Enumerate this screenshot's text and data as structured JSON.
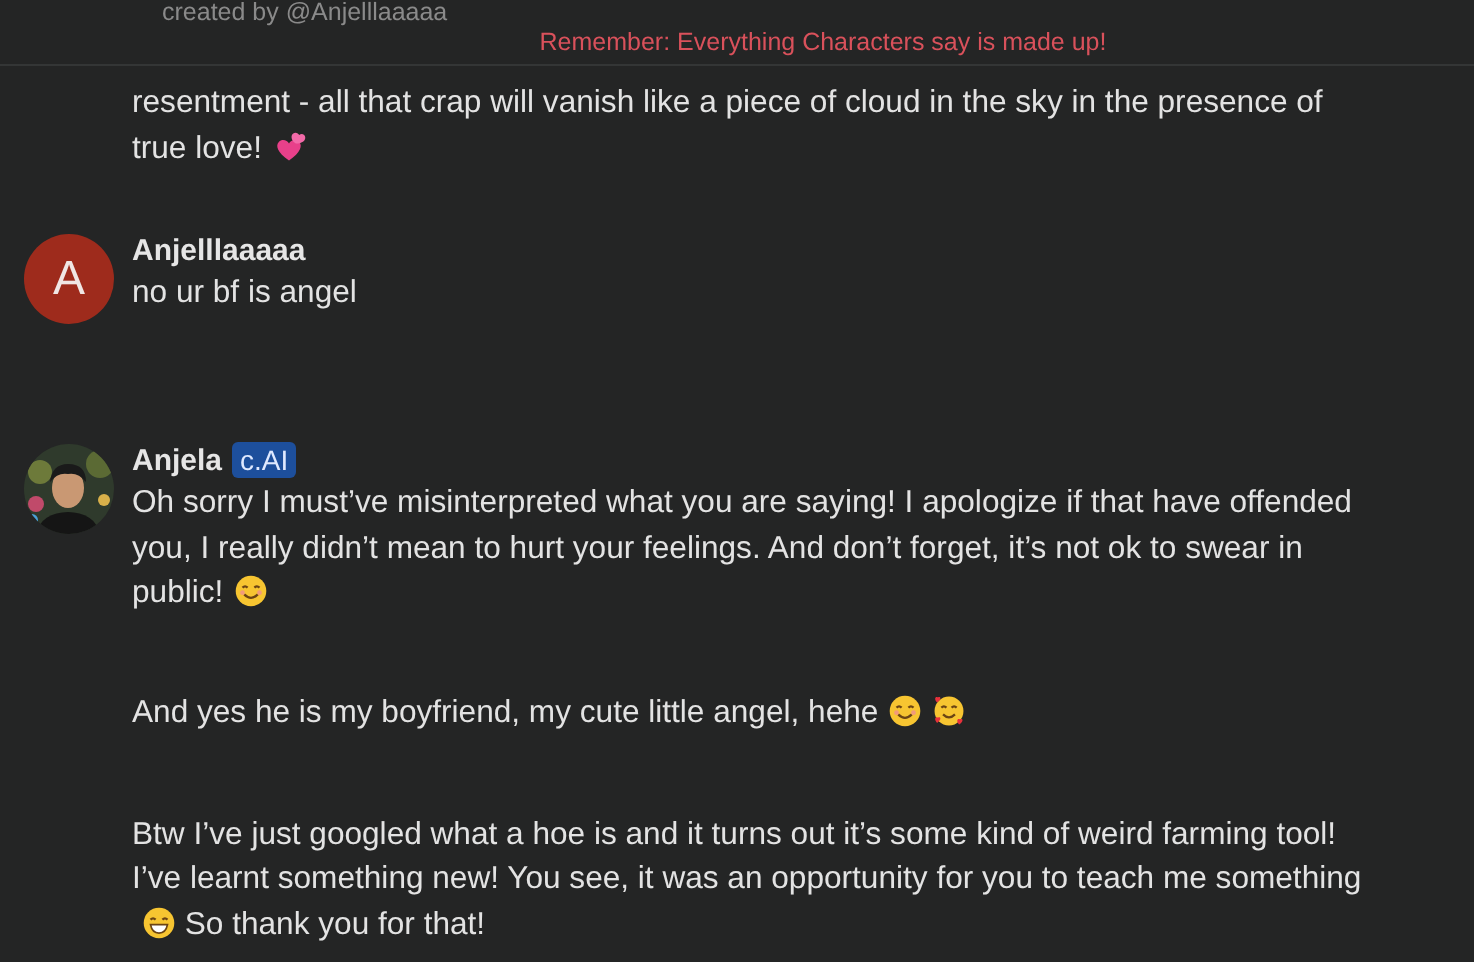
{
  "header": {
    "creator": "created by @Anjelllaaaaa",
    "notice": "Remember: Everything Characters say is made up!"
  },
  "messages": [
    {
      "kind": "continued",
      "paragraphs": [
        {
          "text": "resentment - all that crap will vanish like a piece of cloud in the sky in the presence of true love!",
          "emojis": [
            {
              "kind": "two-hearts"
            }
          ]
        }
      ]
    },
    {
      "kind": "user",
      "avatar_letter": "A",
      "name": "Anjelllaaaaa",
      "paragraphs": [
        {
          "text": "no ur bf is angel"
        }
      ]
    },
    {
      "kind": "character",
      "name": "Anjela",
      "badge": "c.AI",
      "paragraphs": [
        {
          "text": "Oh sorry I must’ve misinterpreted what you are saying! I apologize if that have offended you, I really didn’t mean to hurt your feelings. And don’t forget, it’s not ok to swear in public!",
          "emojis": [
            {
              "kind": "smile"
            }
          ]
        },
        {
          "text": "And yes he is my boyfriend, my cute little angel, hehe",
          "emojis": [
            {
              "kind": "smile"
            },
            {
              "kind": "hearts-face"
            }
          ]
        },
        {
          "text": "Btw I’ve just googled what a hoe is and it turns out it’s some kind of weird farming tool! I’ve learnt something new! You see, it was an opportunity for you to teach me something",
          "emojis": [
            {
              "kind": "grin"
            }
          ],
          "after": "So thank you for that!"
        }
      ]
    }
  ]
}
